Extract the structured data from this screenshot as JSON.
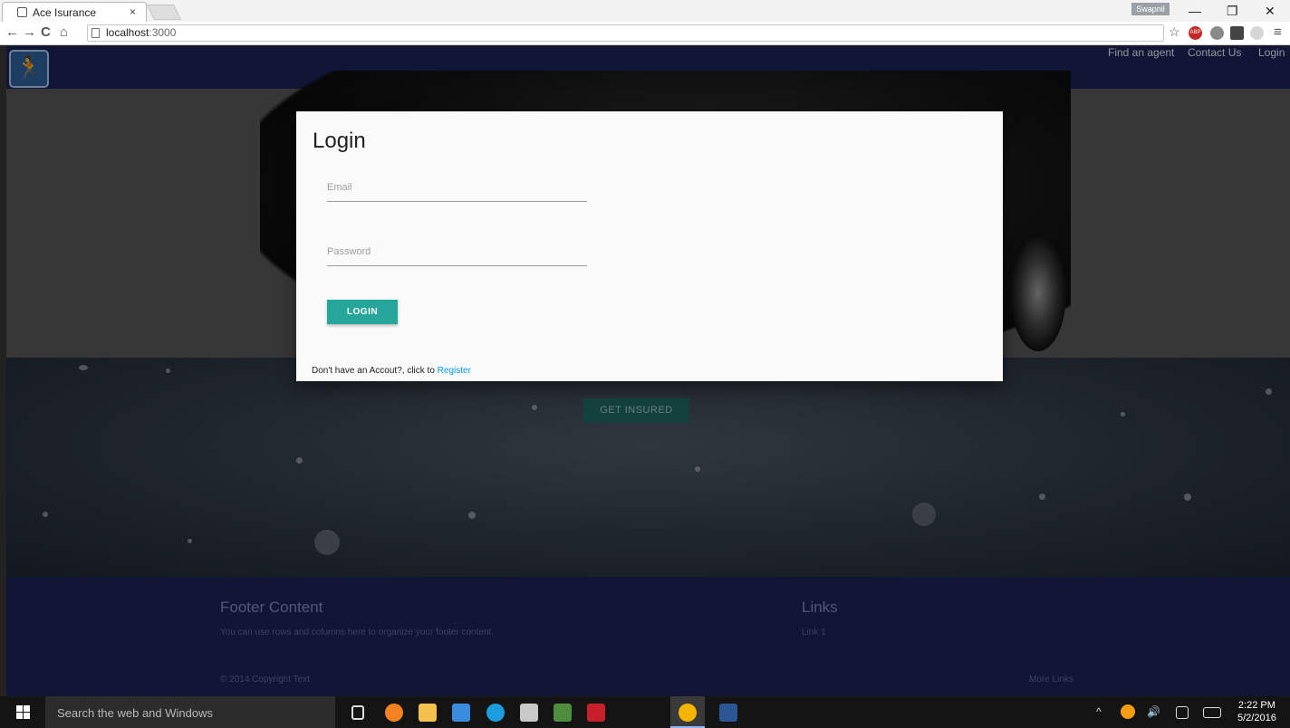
{
  "browser": {
    "tab_title": "Ace Isurance",
    "tab_close": "×",
    "profile_name": "Swapnil",
    "url_host": "localhost",
    "url_port": ":3000",
    "controls": {
      "minimize": "—",
      "restore": "❐",
      "close": "✕"
    },
    "nav": {
      "back": "←",
      "forward": "→",
      "reload": "C",
      "home": "⌂"
    },
    "star": "☆",
    "menu": "≡",
    "ext_abp": "ABP"
  },
  "navbar": {
    "logo_glyph": "🏃",
    "links": [
      "Find an agent",
      "Contact Us",
      "Login"
    ]
  },
  "hero": {
    "cta_label": "GET INSURED"
  },
  "footer": {
    "title": "Footer Content",
    "text": "You can use rows and columns here to organize your footer content.",
    "links_title": "Links",
    "link1": "Link 1",
    "copyright": "© 2014 Copyright Text",
    "more_links": "More Links"
  },
  "login_modal": {
    "title": "Login",
    "email_placeholder": "Email",
    "password_placeholder": "Password",
    "button_label": "LOGIN",
    "register_prompt": "Don't have an Accout?, click to ",
    "register_link": "Register"
  },
  "taskbar": {
    "search_placeholder": "Search the web and Windows",
    "time": "2:22 PM",
    "date": "5/2/2016",
    "tray_up": "^",
    "volume": "🔊"
  },
  "colors": {
    "navbar_bg": "#1b2253",
    "accent": "#26a69a",
    "link": "#039be5"
  }
}
